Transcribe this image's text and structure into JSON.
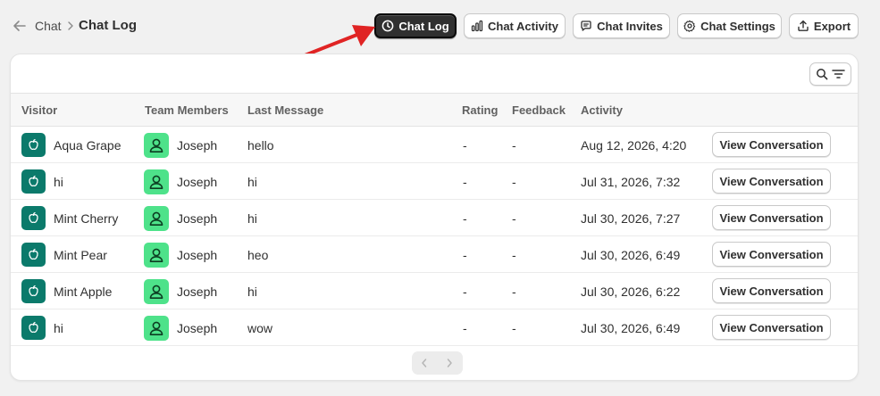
{
  "breadcrumb": {
    "parent": "Chat",
    "current": "Chat Log"
  },
  "tabs": [
    {
      "label": "Chat Log",
      "icon": "clock-icon",
      "active": true
    },
    {
      "label": "Chat Activity",
      "icon": "bar-chart-icon",
      "active": false
    },
    {
      "label": "Chat Invites",
      "icon": "chat-bubble-icon",
      "active": false
    },
    {
      "label": "Chat Settings",
      "icon": "gear-icon",
      "active": false
    },
    {
      "label": "Export",
      "icon": "upload-icon",
      "active": false
    }
  ],
  "table": {
    "columns": [
      "Visitor",
      "Team Members",
      "Last Message",
      "Rating",
      "Feedback",
      "Activity"
    ],
    "action_label": "View Conversation",
    "rows": [
      {
        "visitor": "Aqua Grape",
        "member": "Joseph",
        "message": "hello",
        "rating": "-",
        "feedback": "-",
        "activity": "Aug 12, 2026, 4:20"
      },
      {
        "visitor": "hi",
        "member": "Joseph",
        "message": "hi",
        "rating": "-",
        "feedback": "-",
        "activity": "Jul 31, 2026, 7:32"
      },
      {
        "visitor": "Mint Cherry",
        "member": "Joseph",
        "message": "hi",
        "rating": "-",
        "feedback": "-",
        "activity": "Jul 30, 2026, 7:27"
      },
      {
        "visitor": "Mint Pear",
        "member": "Joseph",
        "message": "heo",
        "rating": "-",
        "feedback": "-",
        "activity": "Jul 30, 2026, 6:49"
      },
      {
        "visitor": "Mint Apple",
        "member": "Joseph",
        "message": "hi",
        "rating": "-",
        "feedback": "-",
        "activity": "Jul 30, 2026, 6:22"
      },
      {
        "visitor": "hi",
        "member": "Joseph",
        "message": "wow",
        "rating": "-",
        "feedback": "-",
        "activity": "Jul 30, 2026, 6:49"
      }
    ]
  },
  "colors": {
    "active_tab": "#303030",
    "visitor_avatar": "#0b7a6b",
    "member_avatar": "#4ee28a",
    "annotation_arrow": "#e02424"
  }
}
